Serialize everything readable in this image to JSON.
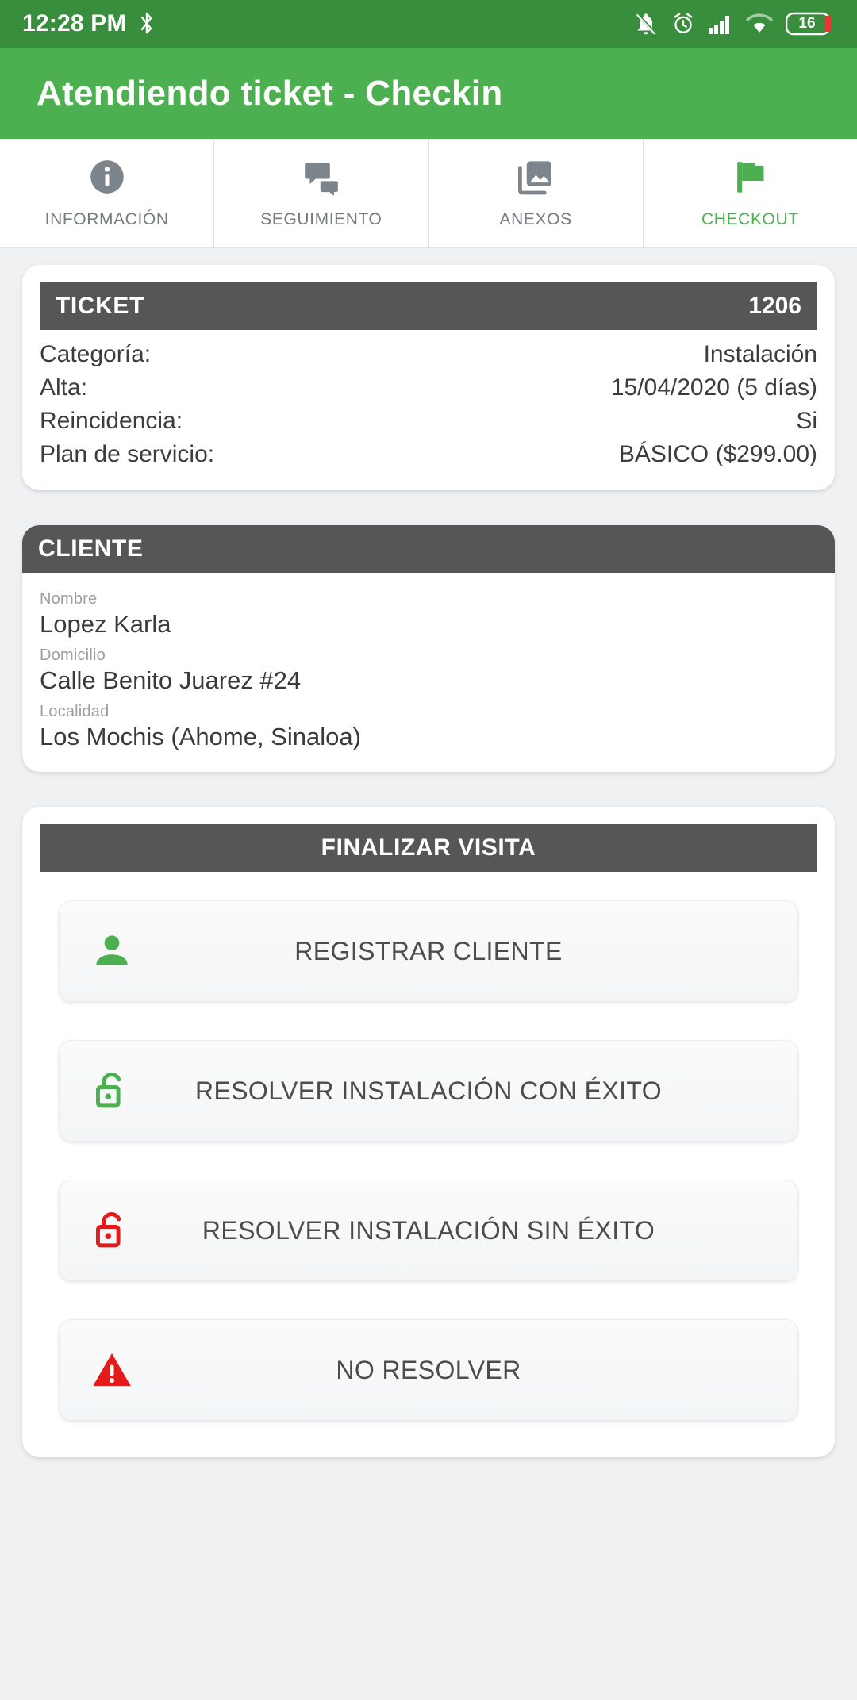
{
  "status_bar": {
    "time": "12:28 PM",
    "battery_level": "16",
    "icons": [
      "bluetooth-icon",
      "notifications-off-icon",
      "alarm-icon",
      "signal-icon",
      "wifi-icon",
      "battery-icon"
    ],
    "background_color": "#388e3c"
  },
  "app_bar": {
    "title": "Atendiendo ticket - Checkin",
    "background_color": "#4caf50"
  },
  "tabs": [
    {
      "label": "INFORMACIÓN",
      "icon": "info-circle-icon",
      "active": false
    },
    {
      "label": "SEGUIMIENTO",
      "icon": "chat-bubbles-icon",
      "active": false
    },
    {
      "label": "ANEXOS",
      "icon": "photo-library-icon",
      "active": false
    },
    {
      "label": "CHECKOUT",
      "icon": "flag-icon",
      "active": true
    }
  ],
  "ticket_card": {
    "header_title": "TICKET",
    "header_value": "1206",
    "rows": [
      {
        "key": "Categoría:",
        "value": "Instalación"
      },
      {
        "key": "Alta:",
        "value": "15/04/2020 (5 días)"
      },
      {
        "key": "Reincidencia:",
        "value": "Si"
      },
      {
        "key": "Plan de servicio:",
        "value": "BÁSICO ($299.00)"
      }
    ]
  },
  "client_card": {
    "header_title": "CLIENTE",
    "fields": [
      {
        "label": "Nombre",
        "value": "Lopez Karla"
      },
      {
        "label": "Domicilio",
        "value": "Calle Benito Juarez #24"
      },
      {
        "label": "Localidad",
        "value": "Los Mochis (Ahome, Sinaloa)"
      }
    ]
  },
  "finalize_card": {
    "header_title": "FINALIZAR VISITA",
    "actions": [
      {
        "label": "REGISTRAR CLIENTE",
        "icon": "person-icon",
        "color": "#4caf50"
      },
      {
        "label": "RESOLVER INSTALACIÓN CON ÉXITO",
        "icon": "lock-open-icon",
        "color": "#4caf50"
      },
      {
        "label": "RESOLVER INSTALACIÓN SIN ÉXITO",
        "icon": "lock-open-icon",
        "color": "#e51b1b"
      },
      {
        "label": "NO RESOLVER",
        "icon": "warning-triangle-icon",
        "color": "#e51b1b"
      }
    ]
  },
  "colors": {
    "primary_green": "#4caf50",
    "dark_green": "#388e3c",
    "header_gray": "#565656",
    "page_background": "#f0f1f3",
    "danger_red": "#e51b1b"
  }
}
